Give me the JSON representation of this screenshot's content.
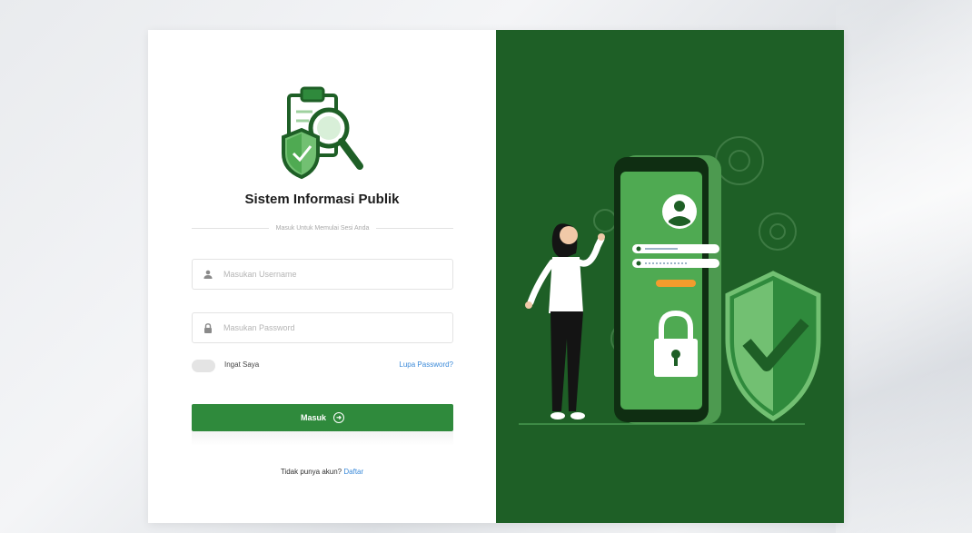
{
  "app": {
    "title": "Sistem Informasi Publik",
    "subtitle": "Masuk Untuk Memulai Sesi Anda"
  },
  "form": {
    "username_placeholder": "Masukan Username",
    "username_value": "",
    "password_placeholder": "Masukan Password",
    "password_value": "",
    "remember_label": "Ingat Saya",
    "remember_checked": false,
    "forgot_label": "Lupa Password?",
    "login_label": "Masuk",
    "signup_prompt": "Tidak punya akun?",
    "signup_link": "Daftar"
  },
  "icons": {
    "logo": "clipboard-shield-magnifier-icon",
    "username": "user-icon",
    "password": "lock-icon",
    "login": "arrow-circle-right-icon"
  },
  "colors": {
    "primary_green": "#2f8a3c",
    "panel_green": "#1e5f26",
    "light_green": "#72c072",
    "link_blue": "#3b8ad9"
  }
}
